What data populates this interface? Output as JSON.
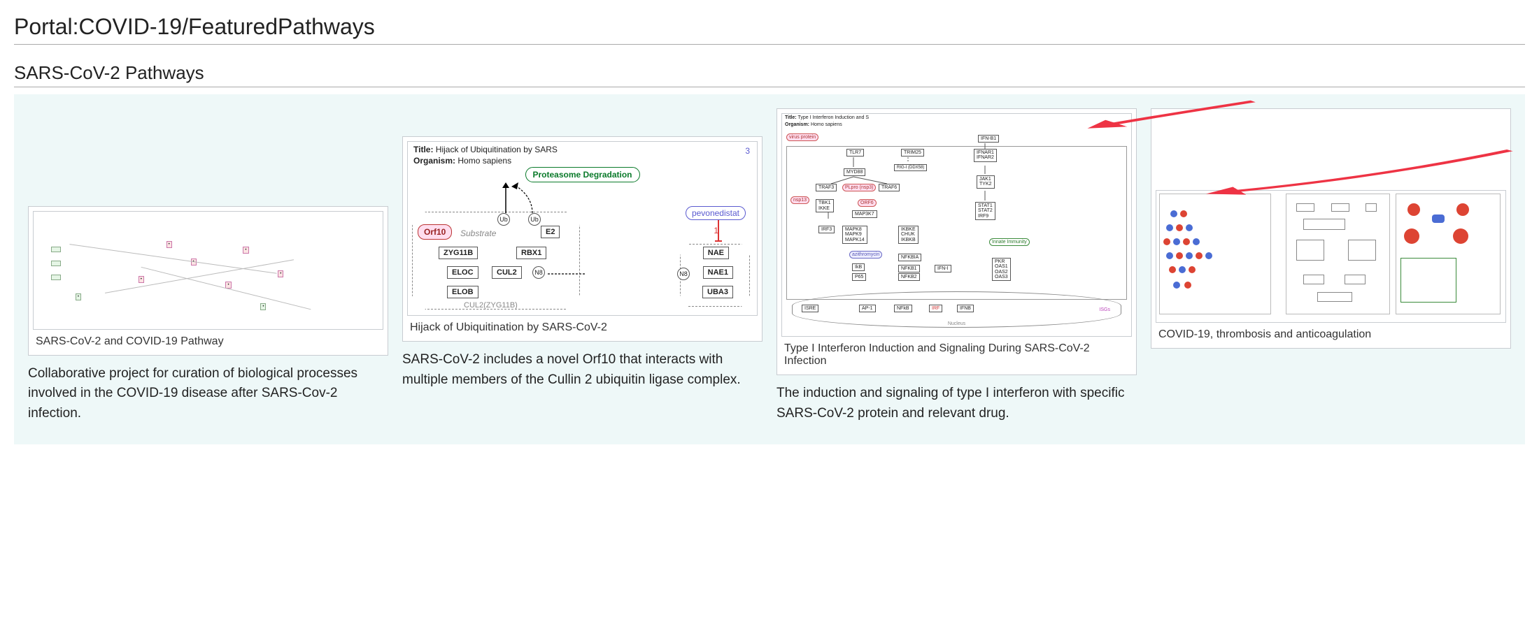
{
  "page": {
    "title": "Portal:COVID-19/FeaturedPathways"
  },
  "section": {
    "title": "SARS-CoV-2 Pathways"
  },
  "gallery": [
    {
      "caption": "SARS-CoV-2 and COVID-19 Pathway",
      "description": "Collaborative project for curation of biological processes involved in the COVID-19 disease after SARS-Cov-2 infection."
    },
    {
      "caption": "Hijack of Ubiquitination by SARS-CoV-2",
      "description": "SARS-CoV-2 includes a novel Orf10 that interacts with multiple members of the Cullin 2 ubiquitin ligase complex.",
      "diagram": {
        "title_label": "Title:",
        "title_value": "Hijack of Ubiquitination by SARS",
        "org_label": "Organism:",
        "org_value": "Homo sapiens",
        "note_num": "3",
        "proteasome": "Proteasome Degradation",
        "orf10": "Orf10",
        "substrate": "Substrate",
        "zyg11b": "ZYG11B",
        "eloc": "ELOC",
        "elob": "ELOB",
        "cul2": "CUL2",
        "rbx1": "RBX1",
        "e2": "E2",
        "ub": "Ub",
        "n8": "N8",
        "complex": "CUL2(ZYG11B)",
        "drug": "pevonedistat",
        "one": "1",
        "nae": "NAE",
        "nae1": "NAE1",
        "uba3": "UBA3"
      }
    },
    {
      "caption": "Type I Interferon Induction and Signaling During SARS-CoV-2 Infection",
      "description": "The induction and signaling of type I interferon with specific SARS-CoV-2 protein and relevant drug.",
      "diagram": {
        "title_label": "Title:",
        "title_value": "Type I Interferon Induction and S",
        "org_label": "Organism:",
        "org_value": "Homo sapiens",
        "virus": "virus protein",
        "tlr7": "TLR7",
        "myd88": "MYD88",
        "traf3": "TRAF3",
        "traf6": "TRAF6",
        "plpro": "PLpro (nsp3)",
        "nsp13": "nsp13",
        "tbk1": "TBK1",
        "ikke": "IKKE",
        "irf3": "IRF3",
        "orf6": "ORF6",
        "mapk_group": "MAPK8\nMAPK9\nMAPK14",
        "map3k7": "MAP3K7",
        "azith": "azithromycin",
        "ikb": "IkB",
        "p65": "P65",
        "trim25": "TRIM25",
        "rig": "RIG-I (DDX58)",
        "ikbke": "IKBKE\nCHUK\nIKBKB",
        "nfkbia": "NFKBIA",
        "nfkb1": "NFKB1",
        "nfkb2": "NFKB2",
        "ifn1": "IFN-I",
        "ifnb1": "IFN-B1",
        "ifnar1": "IFNAR1",
        "ifnar2": "IFNAR2",
        "jak1": "JAK1",
        "tyk2": "TYK2",
        "stat1": "STAT1",
        "stat2": "STAT2",
        "irf9": "IRF9",
        "innate": "Innate Immunity",
        "pkr": "PKR",
        "oas1": "OAS1",
        "oas2": "OAS2",
        "oas3": "OAS3",
        "isre": "ISRE",
        "ap1": "AP-1",
        "nfkb": "NFkB",
        "irf": "IRF",
        "ifnb": "IFNB",
        "isgs": "ISGs",
        "nucleus": "Nucleus"
      }
    },
    {
      "caption": "COVID-19, thrombosis and anticoagulation",
      "description": ""
    }
  ]
}
